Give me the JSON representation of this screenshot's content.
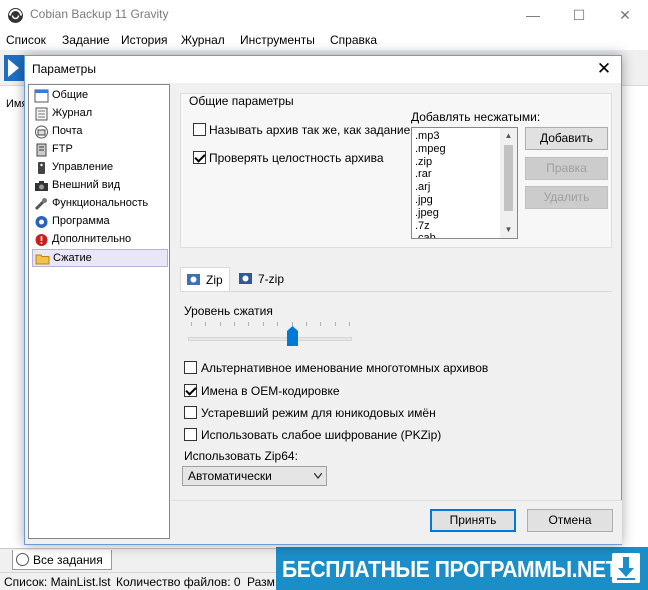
{
  "app": {
    "title": "Cobian Backup 11 Gravity"
  },
  "window_controls": {
    "minimize": "—",
    "maximize": "☐",
    "close": "✕"
  },
  "menu": [
    "Список",
    "Задание",
    "История",
    "Журнал",
    "Инструменты",
    "Справка"
  ],
  "main": {
    "column_header": "Имя"
  },
  "bottom_tab": {
    "label": "Все задания"
  },
  "status": {
    "list": "Список: MainList.lst",
    "files": "Количество файлов: 0",
    "size": "Разм"
  },
  "banner": {
    "text": "БЕСПЛАТНЫЕ ПРОГРАММЫ.NET"
  },
  "dialog": {
    "title": "Параметры",
    "close": "✕",
    "nav": [
      "Общие",
      "Журнал",
      "Почта",
      "FTP",
      "Управление",
      "Внешний вид",
      "Функциональность",
      "Программа",
      "Дополнительно",
      "Сжатие"
    ],
    "selected_nav": "Сжатие",
    "general": {
      "title": "Общие параметры",
      "same_name_label": "Называть архив так же, как задание",
      "same_name_checked": false,
      "verify_label": "Проверять целостность архива",
      "verify_checked": true
    },
    "uncompressed": {
      "label": "Добавлять несжатыми:",
      "items": [
        ".mp3",
        ".mpeg",
        ".zip",
        ".rar",
        ".arj",
        ".jpg",
        ".jpeg",
        ".7z",
        ".cab"
      ],
      "add": "Добавить",
      "edit": "Правка",
      "delete": "Удалить"
    },
    "tabs": [
      "Zip",
      "7-zip"
    ],
    "active_tab": "Zip",
    "compression": {
      "label": "Уровень сжатия",
      "level": 7,
      "max": 11
    },
    "options": [
      {
        "label": "Альтернативное именование многотомных архивов",
        "checked": false
      },
      {
        "label": "Имена в OEM-кодировке",
        "checked": true
      },
      {
        "label": "Устаревший режим для юникодовых имён",
        "checked": false
      },
      {
        "label": "Использовать слабое шифрование (PKZip)",
        "checked": false
      }
    ],
    "zip64": {
      "label": "Использовать Zip64:",
      "value": "Автоматически"
    },
    "ok": "Принять",
    "cancel": "Отмена"
  }
}
